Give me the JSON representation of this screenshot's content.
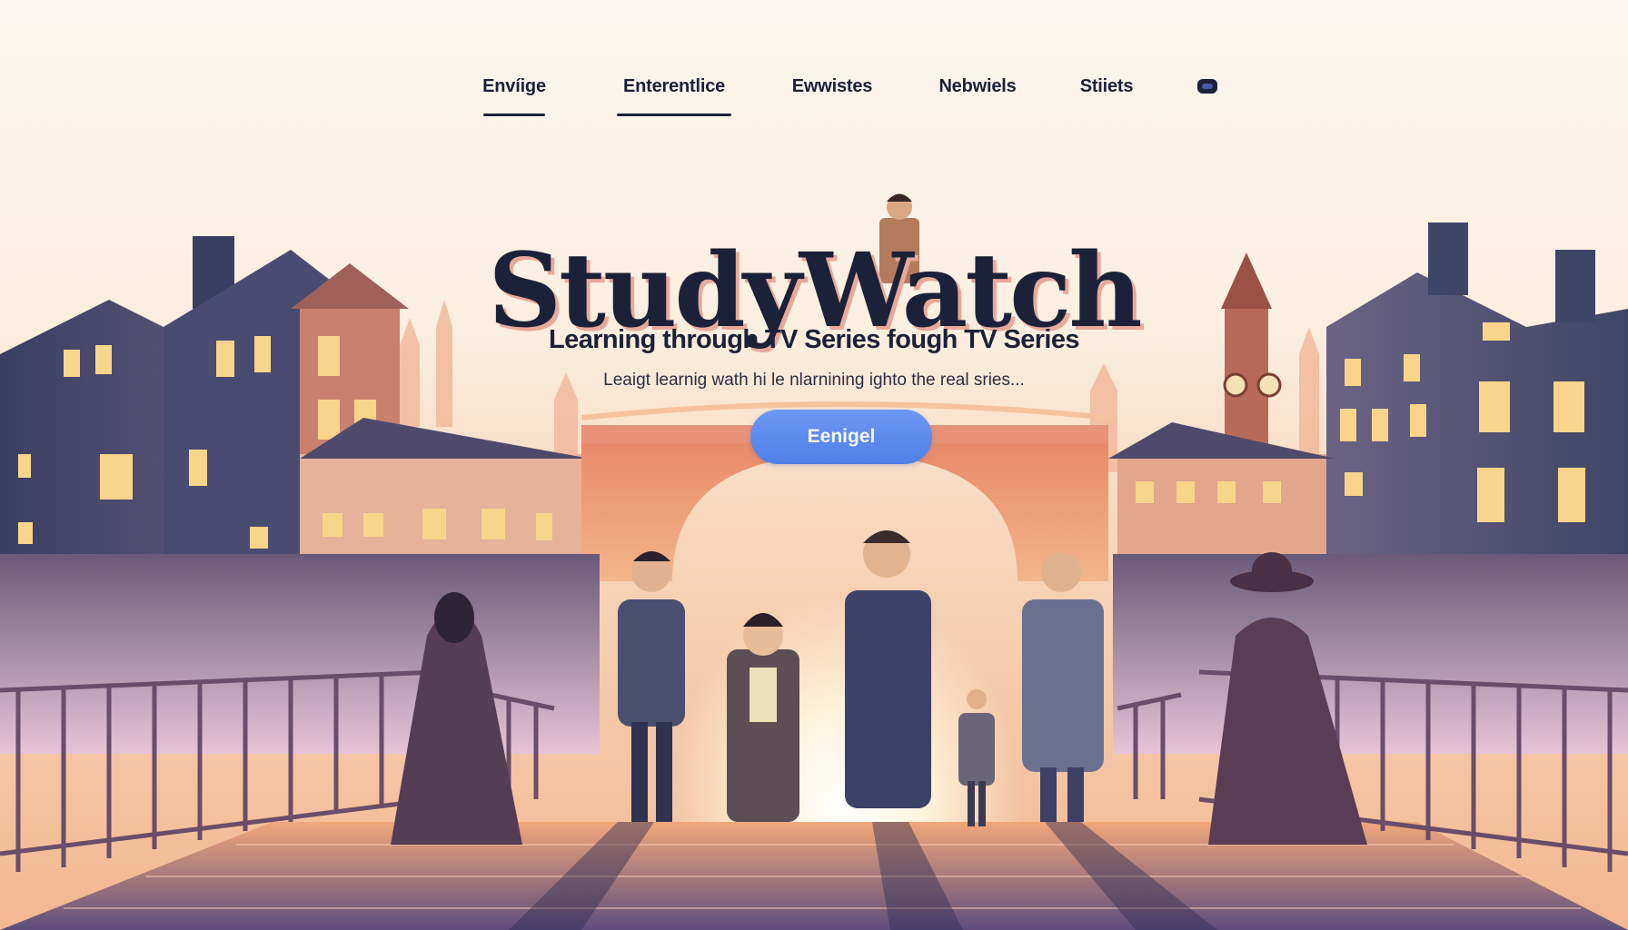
{
  "nav": {
    "items": [
      {
        "label": "Envíige"
      },
      {
        "label": "Enterentlice"
      },
      {
        "label": "Ewwistes"
      },
      {
        "label": "Nebwiels"
      },
      {
        "label": "Stiiets"
      }
    ],
    "toggle_icon": "toggle-icon"
  },
  "hero": {
    "brand": "StudyWatch",
    "tagline": "Learning through TV Series fough  TV Series",
    "subline": "Leaigt learnig wath hi le nlarnining ighto the real sries...",
    "cta_label": "Eenigel"
  },
  "colors": {
    "text_dark": "#1b2138",
    "cta_blue": "#5b87ee",
    "sky_light": "#fbf4ec",
    "sky_peach": "#f6c8a6",
    "building_dark": "#3f4566",
    "window_glow": "#f8d58a"
  }
}
